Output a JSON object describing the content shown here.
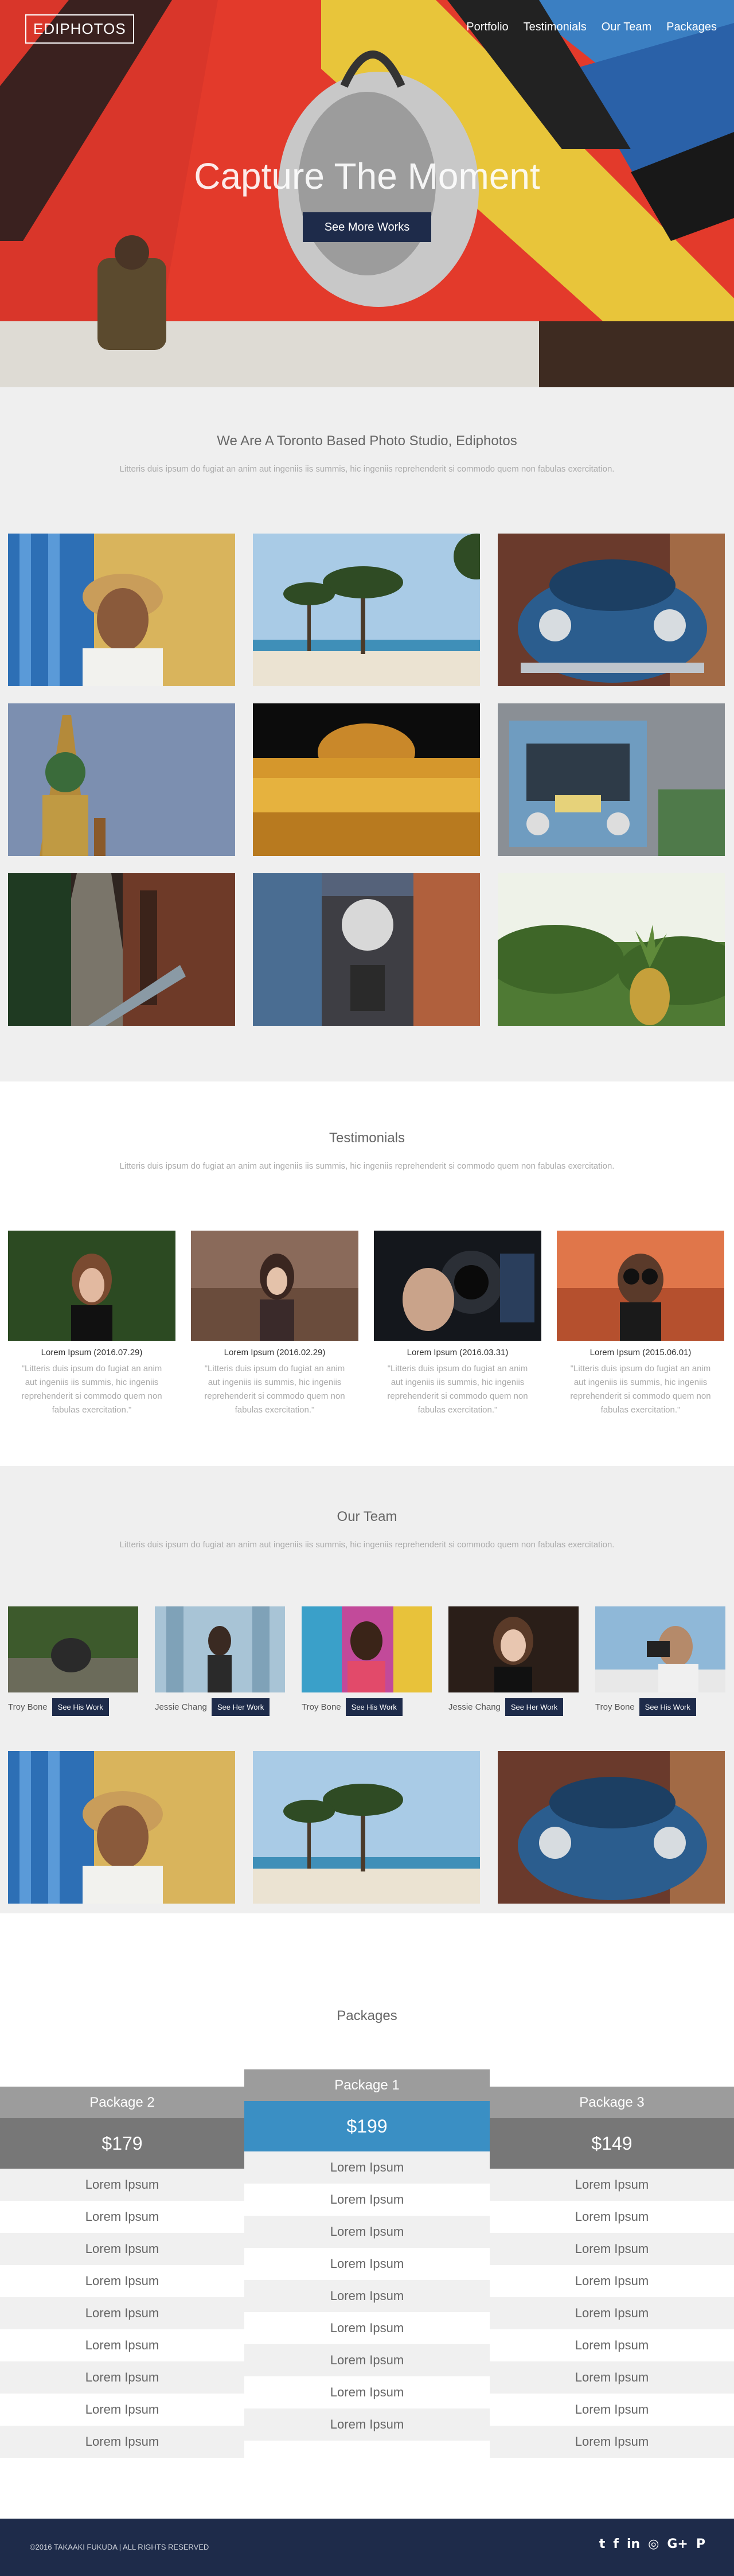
{
  "nav": {
    "logo": "EDIPHOTOS",
    "links": [
      "Portfolio",
      "Testimonials",
      "Our Team",
      "Packages"
    ]
  },
  "hero": {
    "title": "Capture The Moment",
    "button": "See More Works"
  },
  "intro": {
    "title": "We Are A Toronto Based Photo Studio, Ediphotos",
    "subtitle": "Litteris duis ipsum do fugiat an anim aut ingeniis iis summis, hic ingeniis reprehenderit si commodo quem non fabulas exercitation."
  },
  "testimonials": {
    "title": "Testimonials",
    "subtitle": "Litteris duis ipsum do fugiat an anim aut ingeniis iis summis, hic ingeniis reprehenderit si commodo quem non fabulas exercitation.",
    "items": [
      {
        "who": "Lorem Ipsum (2016.07.29)",
        "quote": "\"Litteris duis ipsum do fugiat an anim aut ingeniis iis summis, hic ingeniis reprehenderit si commodo quem non fabulas exercitation.\""
      },
      {
        "who": "Lorem Ipsum (2016.02.29)",
        "quote": "\"Litteris duis ipsum do fugiat an anim aut ingeniis iis summis, hic ingeniis reprehenderit si commodo quem non fabulas exercitation.\""
      },
      {
        "who": "Lorem Ipsum (2016.03.31)",
        "quote": "\"Litteris duis ipsum do fugiat an anim aut ingeniis iis summis, hic ingeniis reprehenderit si commodo quem non fabulas exercitation.\""
      },
      {
        "who": "Lorem Ipsum (2015.06.01)",
        "quote": "\"Litteris duis ipsum do fugiat an anim aut ingeniis iis summis, hic ingeniis reprehenderit si commodo quem non fabulas exercitation.\""
      }
    ]
  },
  "team": {
    "title": "Our Team",
    "subtitle": "Litteris duis ipsum do fugiat an anim aut ingeniis iis summis, hic ingeniis reprehenderit si commodo quem non fabulas exercitation.",
    "members": [
      {
        "name": "Troy Bone",
        "button": "See His Work"
      },
      {
        "name": "Jessie Chang",
        "button": "See Her Work"
      },
      {
        "name": "Troy Bone",
        "button": "See His Work"
      },
      {
        "name": "Jessie Chang",
        "button": "See Her Work"
      },
      {
        "name": "Troy Bone",
        "button": "See His Work"
      }
    ]
  },
  "packages": {
    "title": "Packages",
    "items": [
      {
        "name": "Package 2",
        "price": "$179",
        "features": [
          "Lorem Ipsum",
          "Lorem Ipsum",
          "Lorem Ipsum",
          "Lorem Ipsum",
          "Lorem Ipsum",
          "Lorem Ipsum",
          "Lorem Ipsum",
          "Lorem Ipsum",
          "Lorem Ipsum"
        ]
      },
      {
        "name": "Package 1",
        "price": "$199",
        "features": [
          "Lorem Ipsum",
          "Lorem Ipsum",
          "Lorem Ipsum",
          "Lorem Ipsum",
          "Lorem Ipsum",
          "Lorem Ipsum",
          "Lorem Ipsum",
          "Lorem Ipsum",
          "Lorem Ipsum"
        ]
      },
      {
        "name": "Package 3",
        "price": "$149",
        "features": [
          "Lorem Ipsum",
          "Lorem Ipsum",
          "Lorem Ipsum",
          "Lorem Ipsum",
          "Lorem Ipsum",
          "Lorem Ipsum",
          "Lorem Ipsum",
          "Lorem Ipsum",
          "Lorem Ipsum"
        ]
      }
    ],
    "colors": {
      "header": "#9c9c9c",
      "price_dark": "#777777",
      "price_featured": "#3a8fc4"
    }
  },
  "footer": {
    "copyright": "©2016 TAKAAKI FUKUDA | ALL RIGHTS RESERVED",
    "social_icons": [
      "twitter-icon",
      "facebook-icon",
      "linkedin-icon",
      "instagram-icon",
      "google-plus-icon",
      "pinterest-icon"
    ],
    "social_glyphs": [
      "t",
      "f",
      "in",
      "◎",
      "G+",
      "P"
    ]
  },
  "colors": {
    "navy": "#1e2b4a",
    "page_bg": "#efefef",
    "accent_blue": "#3a8fc4"
  }
}
